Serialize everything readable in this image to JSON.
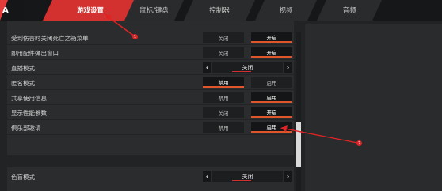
{
  "tabs": [
    {
      "label": "游戏设置",
      "active": true
    },
    {
      "label": "鼠标/键盘",
      "active": false
    },
    {
      "label": "控制器",
      "active": false
    },
    {
      "label": "视频",
      "active": false
    },
    {
      "label": "音频",
      "active": false
    }
  ],
  "logo": {
    "letter": "A"
  },
  "settings": [
    {
      "label": "受到伤害时关闭死亡之箱菜单",
      "left": "关闭",
      "right": "开启",
      "selected": "right"
    },
    {
      "label": "即用配件弹出窗口",
      "left": "关闭",
      "right": "开启",
      "selected": "right"
    },
    {
      "label": "直播模式",
      "value": "关闭"
    },
    {
      "label": "匿名模式",
      "left": "禁用",
      "right": "启用",
      "selected": "left"
    },
    {
      "label": "共享使用信息",
      "left": "禁用",
      "right": "启用",
      "selected": "right"
    },
    {
      "label": "显示性能参数",
      "left": "关闭",
      "right": "开启",
      "selected": "right"
    },
    {
      "label": "俱乐部邀请",
      "left": "禁用",
      "right": "启用",
      "selected": "right"
    }
  ],
  "section2": [
    {
      "label": "色盲模式",
      "value": "关闭"
    }
  ],
  "annotations": [
    {
      "number": "1"
    },
    {
      "number": "2"
    }
  ],
  "colors": {
    "accent": "#d2312f",
    "selected_underline": "#e0552a",
    "annotation": "#e02424"
  },
  "icons": {
    "arrow_left": "‹",
    "arrow_right": "›"
  }
}
